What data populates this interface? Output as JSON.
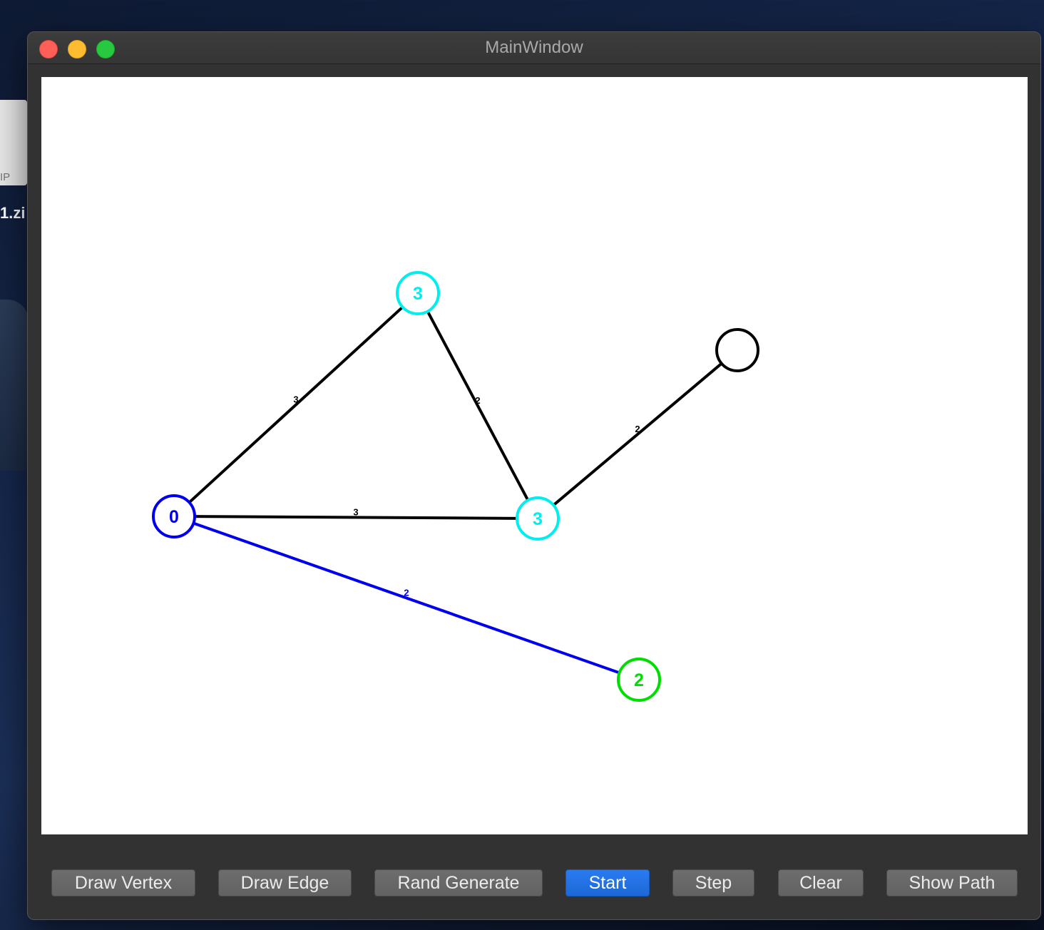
{
  "desktop": {
    "file_label": "IP",
    "file_name": "1.zi"
  },
  "window": {
    "title": "MainWindow"
  },
  "graph": {
    "vertices": [
      {
        "id": "a",
        "label": "0",
        "color": "#0000ee"
      },
      {
        "id": "b",
        "label": "3",
        "color": "#00eeee"
      },
      {
        "id": "c",
        "label": "3",
        "color": "#00eeee"
      },
      {
        "id": "d",
        "label": "",
        "color": "#000000"
      },
      {
        "id": "e",
        "label": "2",
        "color": "#00dd00"
      }
    ],
    "edges": [
      {
        "from": "a",
        "to": "b",
        "weight": "3",
        "color": "#000000"
      },
      {
        "from": "b",
        "to": "c",
        "weight": "2",
        "color": "#000000"
      },
      {
        "from": "a",
        "to": "c",
        "weight": "3",
        "color": "#000000"
      },
      {
        "from": "c",
        "to": "d",
        "weight": "2",
        "color": "#000000"
      },
      {
        "from": "a",
        "to": "e",
        "weight": "2",
        "color": "#0000ee"
      }
    ]
  },
  "toolbar": {
    "draw_vertex": "Draw Vertex",
    "draw_edge": "Draw Edge",
    "rand_generate": "Rand Generate",
    "start": "Start",
    "step": "Step",
    "clear": "Clear",
    "show_path": "Show Path"
  }
}
